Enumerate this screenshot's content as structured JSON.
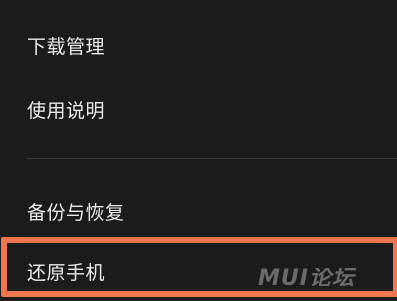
{
  "menu": {
    "items": [
      {
        "label": "下载管理"
      },
      {
        "label": "使用说明"
      },
      {
        "label": "备份与恢复"
      },
      {
        "label": "还原手机"
      }
    ]
  },
  "highlight": {
    "color": "#f0764f",
    "target": "还原手机"
  },
  "watermark": {
    "text": "MUI论坛"
  },
  "colors": {
    "background": "#1b1b1b",
    "text": "#ebebeb",
    "divider": "#3a3a3a"
  }
}
